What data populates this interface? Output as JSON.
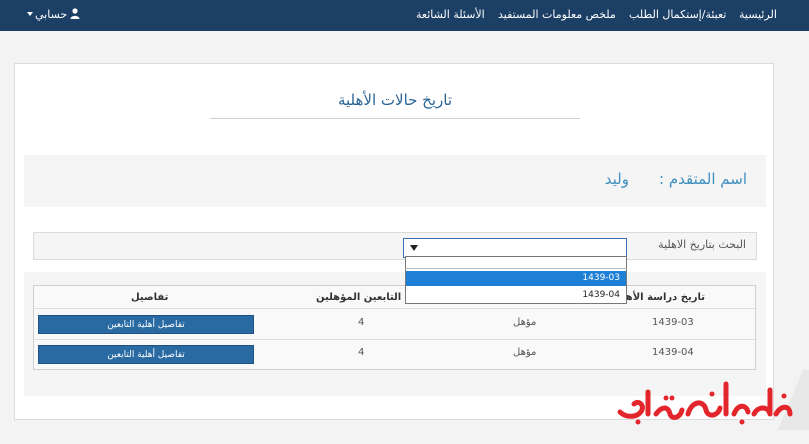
{
  "nav": {
    "account": "حسابي",
    "items": [
      "الرئيسية",
      "تعبئة/إستكمال الطلب",
      "ملخص معلومات المستفيد",
      "الأسئلة الشائعة"
    ]
  },
  "page": {
    "title": "تاريخ حالات الأهلية",
    "name_label": "اسم المتقدم :",
    "name_value": "وليد"
  },
  "search": {
    "label": "البحث بتاريخ الاهلية",
    "selected": "",
    "options": [
      "",
      "1439-03",
      "1439-04"
    ],
    "highlighted": "1439-03"
  },
  "table": {
    "headers": [
      "تاريخ دراسة الأهلية",
      "",
      "عدد التابعين المؤهلين",
      "تفاصيل"
    ],
    "rows": [
      {
        "date": "1439-03",
        "status": "مؤهل",
        "count": "4",
        "details": "تفاصيل أهلية التابعين"
      },
      {
        "date": "1439-04",
        "status": "مؤهل",
        "count": "4",
        "details": "تفاصيل أهلية التابعين"
      }
    ]
  },
  "watermark": "خدمات السعودية",
  "colors": {
    "navbar": "#1c3f66",
    "accent": "#3d8fbf",
    "button": "#2a6aa3",
    "highlight": "#1e7fd6"
  }
}
